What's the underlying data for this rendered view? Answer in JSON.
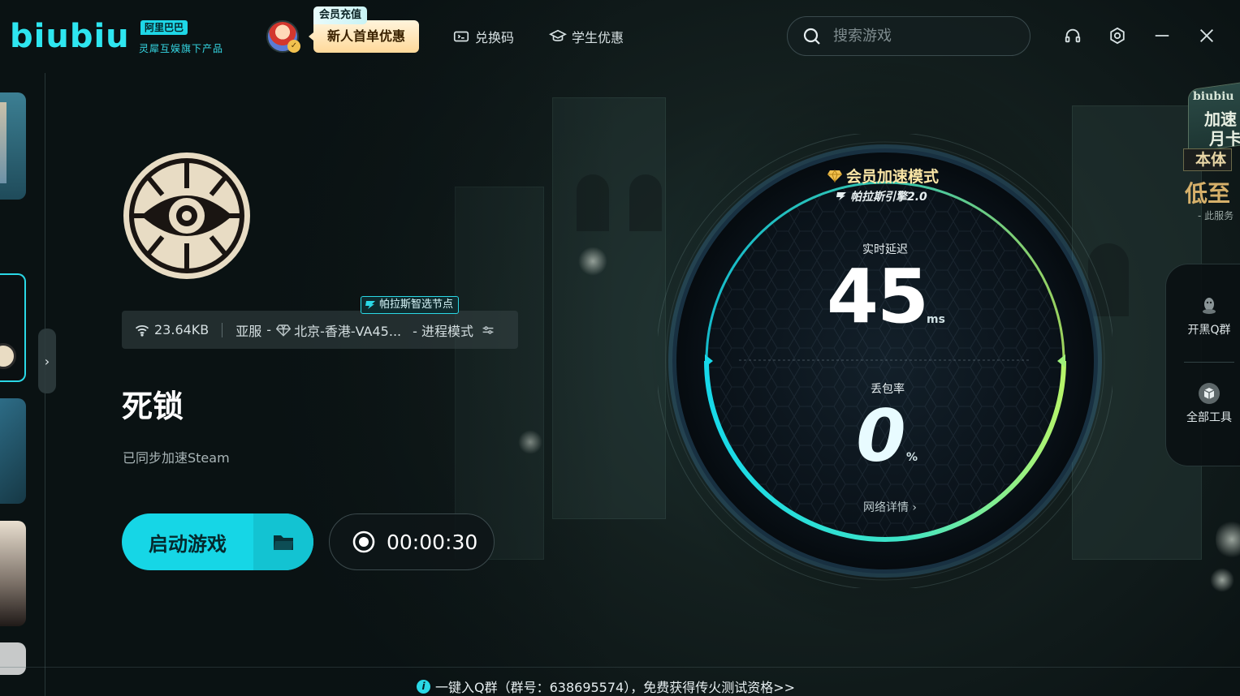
{
  "brand": {
    "logo": "biubiu",
    "badge": "阿里巴巴",
    "subtitle": "灵犀互娱旗下产品"
  },
  "header": {
    "promo_tag": "会员充值",
    "promo_text": "新人首单优惠",
    "nav": [
      {
        "label": "兑换码",
        "icon": "ticket-icon"
      },
      {
        "label": "学生优惠",
        "icon": "graduation-cap-icon"
      }
    ],
    "search_placeholder": "搜索游戏",
    "window_controls": [
      "headset-icon",
      "settings-icon",
      "minimize-icon",
      "close-icon"
    ]
  },
  "game": {
    "title": "死锁",
    "sync_text": "已同步加速Steam",
    "traffic": "23.64KB",
    "region": "亚服",
    "region_sep": "-",
    "node": "北京-香港-VA45...",
    "mode": "- 进程模式",
    "node_tag": "帕拉斯智选节点",
    "start_label": "启动游戏",
    "timer": "00:00:30"
  },
  "dial": {
    "mode": "会员加速模式",
    "engine": "帕拉斯引擎2.0",
    "latency_label": "实时延迟",
    "latency_value": "45",
    "latency_unit": "ms",
    "loss_label": "丢包率",
    "loss_value": "0",
    "loss_unit": "%",
    "detail_link": "网络详情 ›"
  },
  "right_panel": {
    "items": [
      {
        "label": "开黑Q群",
        "icon": "penguin-icon"
      },
      {
        "label": "全部工具",
        "icon": "toolbox-icon"
      }
    ]
  },
  "banner": {
    "line1": "biubiu",
    "line2": "加速",
    "line3": "月卡",
    "line4": "本体",
    "line5": "低至",
    "line6": "- 此服务"
  },
  "footer": {
    "notice": "一键入Q群（群号：638695574），免费获得传火测试资格>>"
  },
  "colors": {
    "accent": "#16d6e6",
    "background": "#0c1517",
    "gold": "#fbe6a6"
  }
}
